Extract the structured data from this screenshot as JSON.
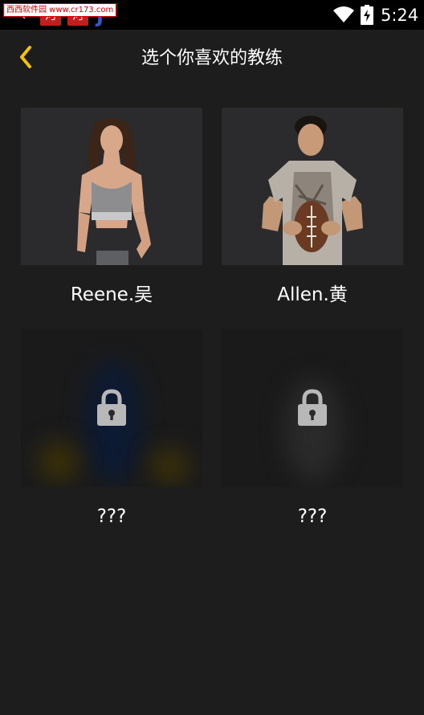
{
  "status_bar": {
    "watermark": "西西软件园 www.cr173.com",
    "app_icon_1": "河",
    "app_icon_2": "河",
    "app_icon_3": "J",
    "time": "5:24",
    "icons": [
      "search-icon",
      "wifi-icon",
      "battery-charging-icon"
    ]
  },
  "header": {
    "title": "选个你喜欢的教练",
    "back_icon": "chevron-left-icon",
    "accent_color": "#f5c400"
  },
  "coaches": [
    {
      "name": "Reene.吴",
      "locked": false
    },
    {
      "name": "Allen.黄",
      "locked": false
    },
    {
      "name": "???",
      "locked": true
    },
    {
      "name": "???",
      "locked": true
    }
  ]
}
